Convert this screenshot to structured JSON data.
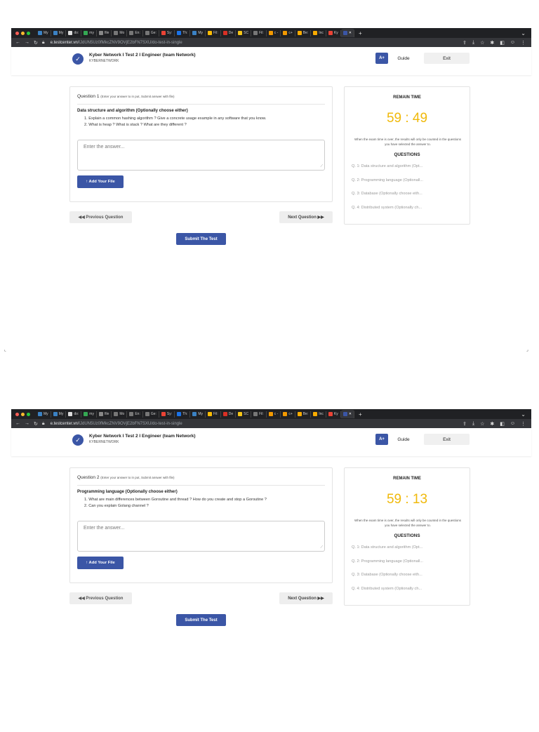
{
  "browser": {
    "tabs": [
      "My",
      "My",
      "do:",
      "my",
      "file",
      "Mo",
      "En:",
      "Ge:",
      "Sy:",
      "Th:",
      "My",
      "Fil:",
      "De",
      "SC",
      "Fil:",
      "c -",
      "c+",
      "Be:",
      "Inc",
      "Ky"
    ],
    "url_host": "e.testcenter.vn/",
    "url_path": "IJdUN5Uz0fMkcZNV9OVjE2bFN7SXU/do-test-in-single"
  },
  "header": {
    "title": "Kyber Network I Test 2 I Engineer (team Network)",
    "subtitle": "KYBERNETWORK",
    "aplus_label": "A+",
    "guide_label": "Guide",
    "exit_label": "Exit"
  },
  "shared": {
    "answer_placeholder": "Enter the answer...",
    "add_file_label": "↑ Add Your File",
    "prev_label": "◀◀ Previous Question",
    "next_label": "Next Question ▶▶",
    "submit_label": "Submit The Test",
    "remain_time_label": "REMAIN TIME",
    "timer_note": "When the exam time is over, the results will only be counted in the questions you have selected the answer to.",
    "questions_label": "QUESTIONS",
    "question_list": [
      "Q. 1: Data structure and algorithm (Opt...",
      "Q. 2: Programming language (Optionall...",
      "Q. 3: Database (Optionally choose eith...",
      "Q. 4: Distributed system (Optionally ch..."
    ]
  },
  "screens": [
    {
      "question_label": "Question 1",
      "question_note": "(Enter your answer to in put, Submit answer with file)",
      "question_title": "Data structure and algorithm (Optionally choose either)",
      "items": [
        "1. Explain a common hashing algorithm ? Give a concrete usage example in any software that you know.",
        "2. What is heap ? What is stack ? What are they different ?"
      ],
      "remain_time": "59 : 49"
    },
    {
      "question_label": "Question 2",
      "question_note": "(Enter your answer to in put, Submit answer with file)",
      "question_title": "Programming language (Optionally choose either)",
      "items": [
        "1. What are main differences between Goroutine and thread ? How do you create and stop a Goroutine ?",
        "2. Can you explain Golang channel ?"
      ],
      "remain_time": "59 : 13"
    }
  ],
  "colors": {
    "accent": "#3b56a6",
    "timer": "#f0b90b",
    "tabbar": "#202124"
  }
}
